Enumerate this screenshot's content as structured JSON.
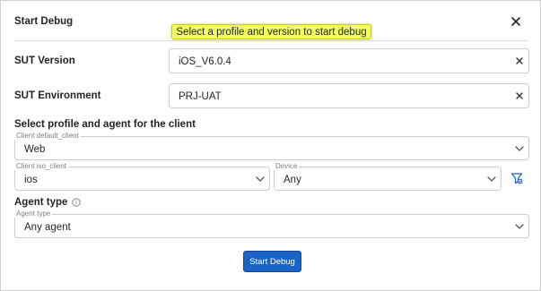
{
  "dialog": {
    "title": "Start Debug",
    "close_icon": "close-icon"
  },
  "tooltip": {
    "text": "Select a profile and version to start debug"
  },
  "sut_version": {
    "label": "SUT Version",
    "value": "iOS_V6.0.4"
  },
  "sut_environment": {
    "label": "SUT Environment",
    "value": "PRJ-UAT"
  },
  "profile_section": {
    "title": "Select profile and agent for the client",
    "default_client": {
      "label": "Client default_client",
      "value": "Web"
    },
    "iso_client": {
      "label": "Client iso_client",
      "value": "ios"
    },
    "device": {
      "label": "Device",
      "value": "Any"
    },
    "filter_icon": "filter-icon"
  },
  "agent": {
    "title": "Agent type",
    "info_icon": "info-icon",
    "field_label": "Agent type",
    "value": "Any agent"
  },
  "actions": {
    "start_label": "Start Debug"
  },
  "colors": {
    "primary": "#1a63c7",
    "tooltip_bg": "#f2ff5c",
    "filter_icon": "#1a63c7"
  }
}
